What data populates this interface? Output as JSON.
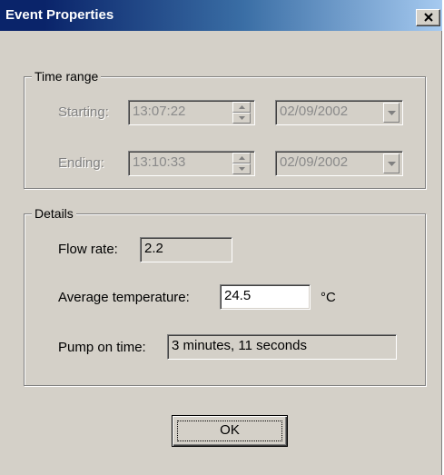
{
  "window": {
    "title": "Event Properties",
    "close_glyph": "×"
  },
  "time_range": {
    "legend": "Time range",
    "starting_label": "Starting:",
    "starting_time": "13:07:22",
    "starting_date": "02/09/2002",
    "ending_label": "Ending:",
    "ending_time": "13:10:33",
    "ending_date": "02/09/2002"
  },
  "details": {
    "legend": "Details",
    "flow_rate_label": "Flow rate:",
    "flow_rate_value": "2.2",
    "avg_temp_label": "Average temperature:",
    "avg_temp_value": "24.5",
    "avg_temp_unit": "°C",
    "pump_on_label": "Pump on time:",
    "pump_on_value": "3 minutes, 11 seconds"
  },
  "buttons": {
    "ok_label": "OK"
  },
  "colors": {
    "title_start": "#0a246a",
    "title_end": "#a6caf0",
    "dialog_face": "#d4d0c8"
  },
  "icons": {
    "close": "close-icon",
    "spin_up": "spin-up-arrow-icon",
    "spin_down": "spin-down-arrow-icon",
    "dropdown": "dropdown-arrow-icon"
  }
}
